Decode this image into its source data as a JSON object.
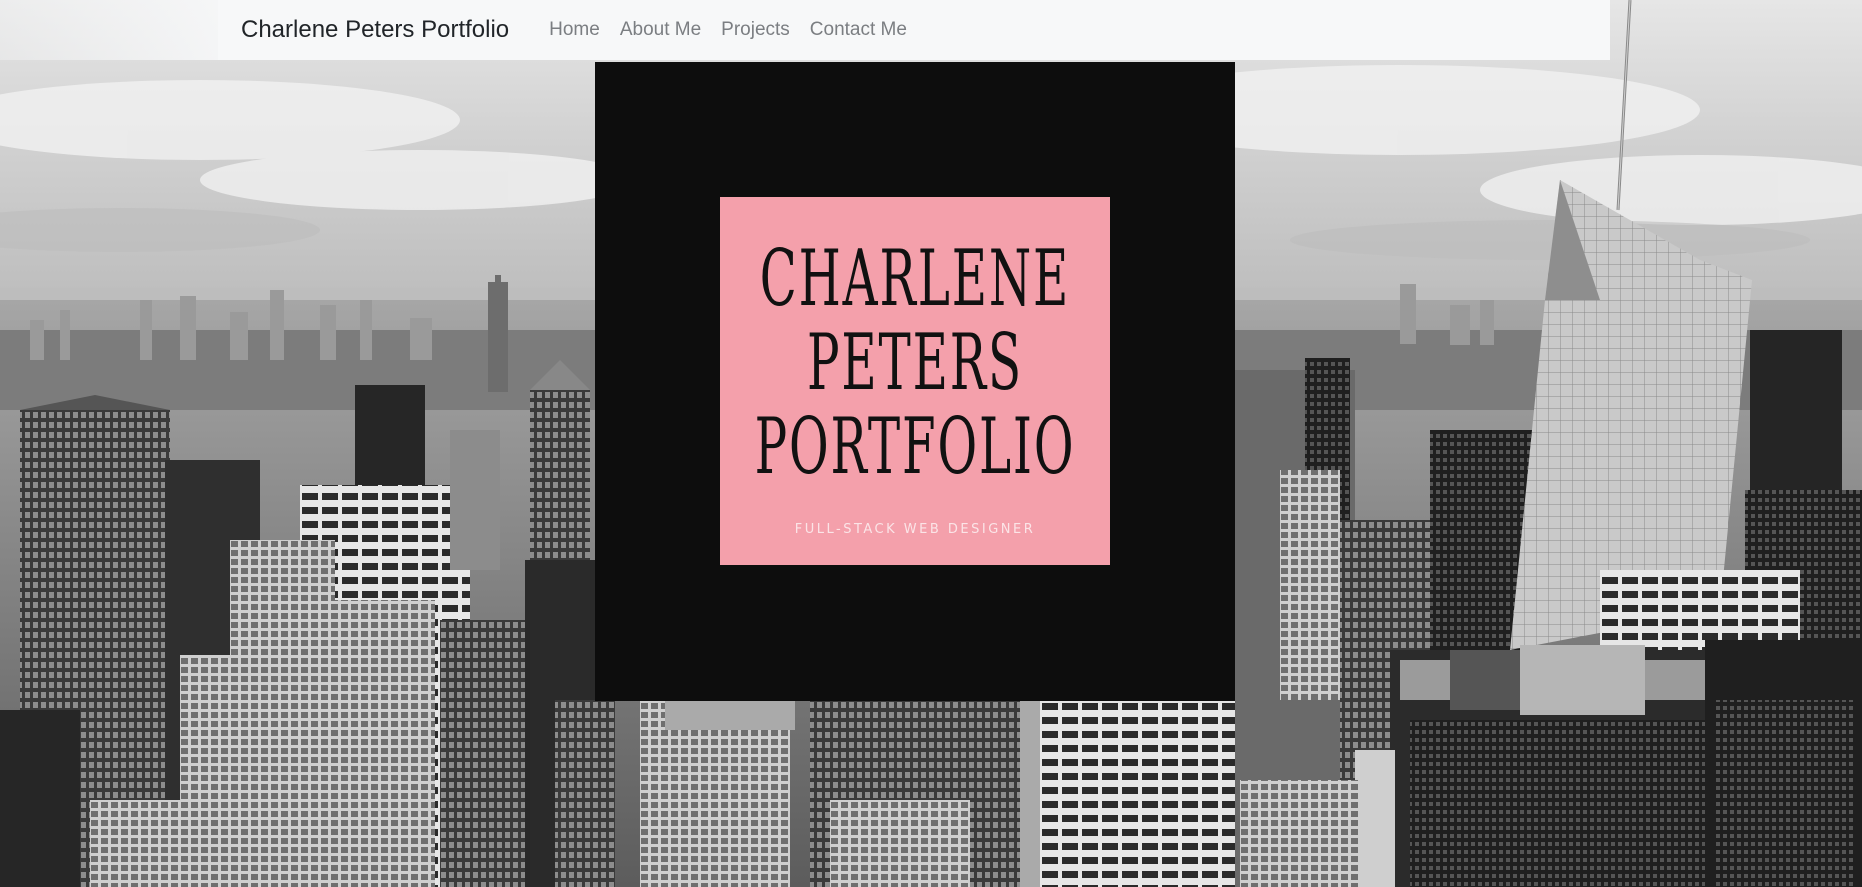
{
  "navbar": {
    "brand": "Charlene Peters Portfolio",
    "links": [
      {
        "label": "Home"
      },
      {
        "label": "About Me"
      },
      {
        "label": "Projects"
      },
      {
        "label": "Contact Me"
      }
    ]
  },
  "hero": {
    "logo": {
      "title_lines": [
        "CHARLENE",
        "PETERS",
        "PORTFOLIO"
      ],
      "subtitle": "FULL-STACK WEB DESIGNER",
      "background_color": "#f4a0ab",
      "frame_color": "#0d0d0d"
    }
  },
  "background": {
    "description_icon": "city-skyline-photo"
  }
}
